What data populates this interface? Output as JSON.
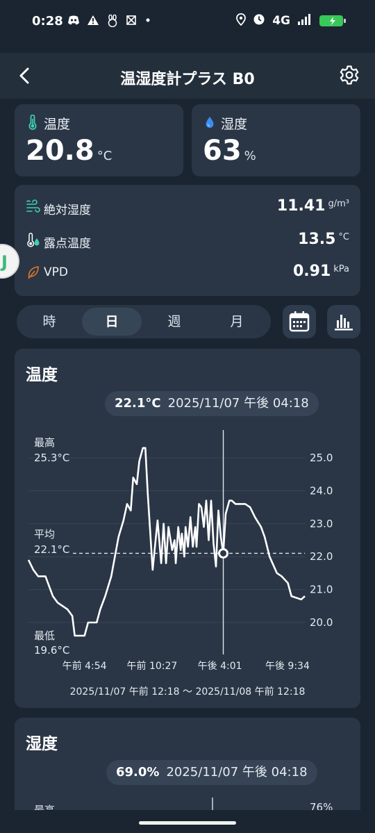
{
  "status_bar": {
    "time": "0:28",
    "network": "4G",
    "left_icons": [
      "discord-icon",
      "warning-icon",
      "bunny-icon",
      "grid-icon",
      "dot-icon"
    ],
    "right_icons": [
      "location-icon",
      "alarm-icon",
      "signal-icon",
      "battery-icon"
    ]
  },
  "header": {
    "title": "温湿度計プラス B0"
  },
  "tiles": {
    "temperature": {
      "label": "温度",
      "value": "20.8",
      "unit": "°C"
    },
    "humidity": {
      "label": "湿度",
      "value": "63",
      "unit": "%"
    }
  },
  "metrics": [
    {
      "label": "絶対湿度",
      "value": "11.41",
      "unit": "g/m³",
      "icon": "wind-icon"
    },
    {
      "label": "露点温度",
      "value": "13.5",
      "unit": "°C",
      "icon": "dew-point-icon"
    },
    {
      "label": "VPD",
      "value": "0.91",
      "unit": "kPa",
      "icon": "leaf-icon"
    }
  ],
  "range_tabs": {
    "items": [
      "時",
      "日",
      "週",
      "月"
    ],
    "active": "日"
  },
  "colors": {
    "background": "#1b2531",
    "card": "#2a3646",
    "line": "#ffffff",
    "leaf": "#e0772b",
    "thermo": "#3fd0b0",
    "drop": "#3a8ef0"
  },
  "temp_chart": {
    "title": "温度",
    "tooltip_value": "22.1°C",
    "tooltip_time": "2025/11/07 午後 04:18",
    "max_label": "最高",
    "max_value": "25.3°C",
    "avg_label": "平均",
    "avg_value": "22.1°C",
    "min_label": "最低",
    "min_value": "19.6°C",
    "range_text": "2025/11/07 午前 12:18 〜 2025/11/08 午前 12:18"
  },
  "humidity_chart": {
    "title": "湿度",
    "tooltip_value": "69.0%",
    "tooltip_time": "2025/11/07 午後 04:18",
    "max_label": "最高",
    "y_top": "76%"
  },
  "chart_data": {
    "type": "line",
    "title": "温度",
    "xlabel": "",
    "ylabel": "",
    "x_tick_labels": [
      "午前 4:54",
      "午前 10:27",
      "午後 4:01",
      "午後 9:34"
    ],
    "x_tick_hours": [
      4.6,
      10.15,
      15.72,
      21.27
    ],
    "y_tick_labels": [
      "20.0",
      "21.0",
      "22.0",
      "23.0",
      "24.0",
      "25.0"
    ],
    "ylim": [
      19.6,
      25.3
    ],
    "grid": true,
    "average": 22.1,
    "selected": {
      "x": 16.0,
      "y": 22.1
    },
    "series": [
      {
        "x": [
          0.0,
          0.4,
          0.8,
          1.4,
          1.7,
          2.0,
          2.4,
          3.2,
          3.6,
          3.8,
          4.6,
          4.9,
          5.6,
          5.9,
          6.3,
          6.8,
          7.0,
          7.4,
          7.8,
          8.1,
          8.4,
          8.6,
          8.9,
          9.1,
          9.4,
          9.6,
          9.8,
          10.2,
          10.6,
          10.9,
          11.1,
          11.3,
          11.5,
          11.8,
          12.0,
          12.1,
          12.3,
          12.5,
          12.6,
          12.8,
          12.9,
          13.1,
          13.3,
          13.5,
          13.7,
          13.8,
          14.0,
          14.2,
          14.4,
          14.6,
          14.8,
          15.0,
          15.2,
          15.4,
          15.6,
          15.8,
          16.0,
          16.2,
          16.5,
          16.7,
          17.0,
          17.8,
          18.2,
          18.6,
          19.1,
          19.4,
          19.8,
          20.4,
          20.8,
          21.3,
          21.6,
          22.4,
          22.7
        ],
        "y": [
          21.9,
          21.6,
          21.4,
          21.4,
          21.1,
          20.8,
          20.6,
          20.4,
          20.2,
          19.6,
          19.6,
          20.0,
          20.0,
          20.4,
          20.8,
          21.4,
          21.8,
          22.6,
          23.1,
          23.6,
          23.4,
          24.4,
          24.2,
          24.9,
          25.3,
          25.3,
          23.9,
          21.6,
          23.1,
          21.8,
          23.0,
          21.8,
          22.9,
          22.2,
          22.5,
          21.8,
          22.9,
          22.2,
          22.7,
          22.0,
          22.9,
          22.3,
          23.2,
          22.3,
          22.9,
          22.3,
          23.6,
          23.5,
          22.9,
          23.7,
          22.5,
          23.7,
          22.4,
          21.7,
          23.4,
          22.6,
          22.1,
          23.3,
          23.7,
          23.7,
          23.6,
          23.6,
          23.5,
          23.2,
          22.9,
          22.6,
          22.0,
          21.5,
          21.4,
          21.2,
          20.8,
          20.7,
          20.8
        ]
      }
    ]
  }
}
